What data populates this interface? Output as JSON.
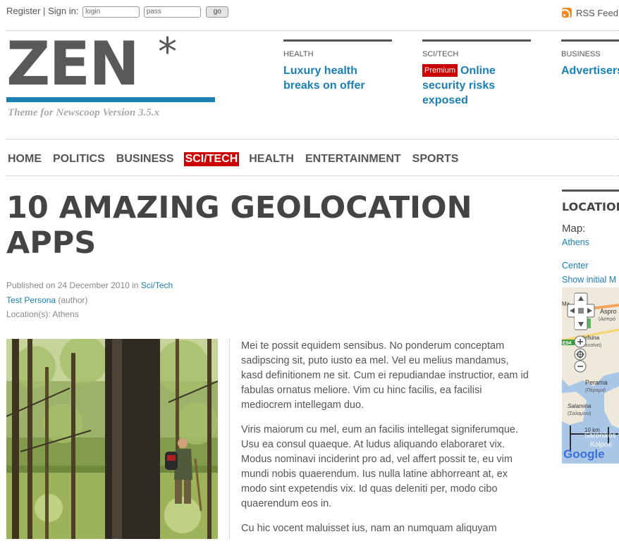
{
  "topbar": {
    "register": "Register",
    "sep": "|",
    "signin": "Sign in:",
    "login_value": "login",
    "pass_value": "pass",
    "go": "go",
    "rss": "RSS Feed"
  },
  "logo": {
    "word": "ZEN",
    "star": "*",
    "tagline": "Theme for Newscoop Version 3.5.x"
  },
  "teasers": [
    {
      "category": "HEALTH",
      "title": "Luxury health breaks on offer"
    },
    {
      "category": "SCI/TECH",
      "badge": "Premium",
      "title": "Online security risks exposed"
    },
    {
      "category": "BUSINESS",
      "title": "Advertisers online dem"
    }
  ],
  "nav": [
    "HOME",
    "POLITICS",
    "BUSINESS",
    "SCI/TECH",
    "HEALTH",
    "ENTERTAINMENT",
    "SPORTS"
  ],
  "nav_active": "SCI/TECH",
  "article": {
    "title": "10 AMAZING GEOLOCATION APPS",
    "published_prefix": "Published on 24 December 2010 in",
    "section": "Sci/Tech",
    "author": "Test Persona",
    "author_role": "(author)",
    "locations_label": "Location(s):",
    "locations": "Athens",
    "paragraphs": [
      "Mei te possit equidem sensibus. No ponderum conceptam sadipscing sit, puto iusto ea mel. Vel eu melius mandamus, kasd definitionem ne sit. Cum ei repudiandae instructior, eam id fabulas ornatus meliore. Vim cu hinc facilis, ea facilisi mediocrem intellegam duo.",
      "Viris maiorum cu mel, eum an facilis intellegat signiferumque. Usu ea consul quaeque. At ludus aliquando elaboraret vix. Modus nominavi inciderint pro ad, vel affert possit te, eu vim mundi nobis quaerendum. Ius nulla latine abhorreant at, ex modo sint expetendis vix. Id quas deleniti per, modo cibo quaerendum eos in.",
      "Cu hic vocent maluisset ius, nam an numquam aliquyam"
    ]
  },
  "sidebar": {
    "heading": "LOCATION",
    "map_label": "Map:",
    "map_place": "Athens",
    "center": "Center",
    "show_initial": "Show initial M"
  },
  "map_labels": {
    "aspro": "Aspro",
    "aspro_gr": "(Ασπρό",
    "elefsina": "lefsina",
    "elefsina_gr": "λευσίνα)",
    "perama": "Perama",
    "perama_gr": "(Πέραμα)",
    "salamina": "Salamina",
    "salamina_gr": "(Σαλαμίνα)",
    "scale": "10 km",
    "saronikos": "Saronikos",
    "kolpos": "Kolpos",
    "road": "E94",
    "google": "Google",
    "ma": "Ma"
  },
  "colors": {
    "accent": "#1a7fb5",
    "active_nav": "#cc0000",
    "premium": "#cc0000"
  }
}
